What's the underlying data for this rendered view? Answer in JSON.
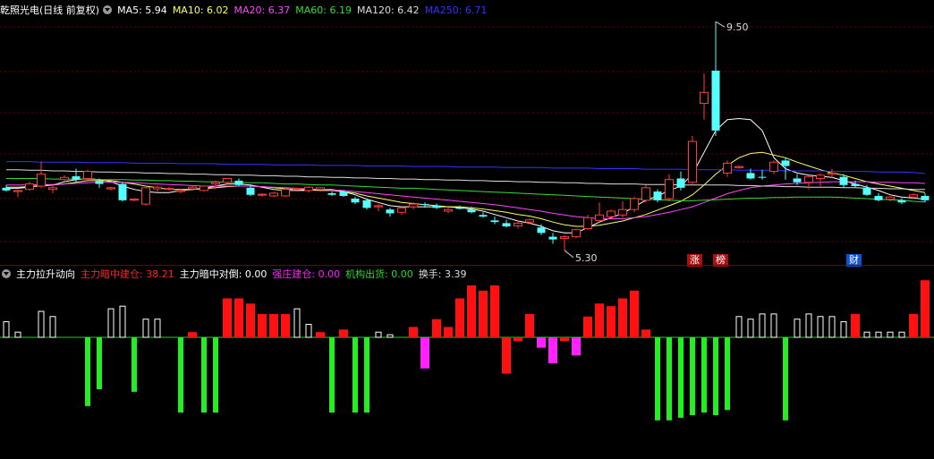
{
  "main_legend": {
    "title": "乾照光电(日线 前复权)",
    "items": [
      {
        "label": "MA5:",
        "value": "5.94",
        "color": "#ffffff"
      },
      {
        "label": "MA10:",
        "value": "6.02",
        "color": "#ffff66"
      },
      {
        "label": "MA20:",
        "value": "6.37",
        "color": "#ff44ff"
      },
      {
        "label": "MA60:",
        "value": "6.19",
        "color": "#33dd33"
      },
      {
        "label": "MA120:",
        "value": "6.42",
        "color": "#dddddd"
      },
      {
        "label": "MA250:",
        "value": "6.71",
        "color": "#3333ff"
      }
    ]
  },
  "price_annotations": {
    "high": "9.50",
    "low": "5.30"
  },
  "badges": [
    {
      "text": "涨",
      "bg": "#aa1111",
      "color": "#ffffff"
    },
    {
      "text": "榜",
      "bg": "#aa1111",
      "color": "#ffffff"
    },
    {
      "text": "财",
      "bg": "#1155cc",
      "color": "#ffffff"
    }
  ],
  "sub_legend": {
    "title": "主力拉升动向",
    "items": [
      {
        "label": "主力暗中建仓:",
        "value": "38.21",
        "color": "#ff2222"
      },
      {
        "label": "主力暗中对倒:",
        "value": "0.00",
        "color": "#ffffff"
      },
      {
        "label": "强庄建仓:",
        "value": "0.00",
        "color": "#ff22ff"
      },
      {
        "label": "机构出货:",
        "value": "0.00",
        "color": "#22dd22"
      },
      {
        "label": "换手:",
        "value": "3.39",
        "color": "#dddddd"
      }
    ]
  },
  "chart_data": {
    "type": "candlestick",
    "y_range": [
      5.1,
      9.7
    ],
    "candles": [
      [
        6.45,
        6.5,
        6.38,
        6.4
      ],
      [
        6.38,
        6.42,
        6.28,
        6.4
      ],
      [
        6.42,
        6.56,
        6.4,
        6.52
      ],
      [
        6.48,
        6.93,
        6.45,
        6.7
      ],
      [
        6.42,
        6.48,
        6.35,
        6.45
      ],
      [
        6.6,
        6.68,
        6.58,
        6.64
      ],
      [
        6.66,
        6.8,
        6.55,
        6.6
      ],
      [
        6.62,
        6.78,
        6.6,
        6.75
      ],
      [
        6.57,
        6.62,
        6.45,
        6.52
      ],
      [
        6.43,
        6.47,
        6.4,
        6.45
      ],
      [
        6.52,
        6.55,
        6.2,
        6.22
      ],
      [
        6.23,
        6.26,
        6.2,
        6.24
      ],
      [
        6.15,
        6.5,
        6.12,
        6.45
      ],
      [
        6.43,
        6.48,
        6.38,
        6.46
      ],
      [
        6.42,
        6.46,
        6.4,
        6.44
      ],
      [
        6.38,
        6.42,
        6.35,
        6.4
      ],
      [
        6.43,
        6.48,
        6.4,
        6.46
      ],
      [
        6.4,
        6.5,
        6.38,
        6.48
      ],
      [
        6.52,
        6.58,
        6.42,
        6.55
      ],
      [
        6.55,
        6.62,
        6.52,
        6.62
      ],
      [
        6.58,
        6.62,
        6.48,
        6.5
      ],
      [
        6.45,
        6.5,
        6.3,
        6.32
      ],
      [
        6.32,
        6.35,
        6.28,
        6.33
      ],
      [
        6.3,
        6.38,
        6.28,
        6.35
      ],
      [
        6.3,
        6.45,
        6.28,
        6.42
      ],
      [
        6.42,
        6.45,
        6.38,
        6.44
      ],
      [
        6.4,
        6.48,
        6.36,
        6.46
      ],
      [
        6.42,
        6.46,
        6.38,
        6.45
      ],
      [
        6.35,
        6.38,
        6.3,
        6.32
      ],
      [
        6.38,
        6.4,
        6.28,
        6.3
      ],
      [
        6.25,
        6.28,
        6.15,
        6.18
      ],
      [
        6.22,
        6.24,
        6.05,
        6.08
      ],
      [
        6.1,
        6.15,
        6.02,
        6.12
      ],
      [
        6.05,
        6.08,
        5.92,
        5.98
      ],
      [
        6.0,
        6.1,
        5.95,
        6.08
      ],
      [
        6.1,
        6.18,
        6.05,
        6.15
      ],
      [
        6.15,
        6.18,
        6.08,
        6.14
      ],
      [
        6.12,
        6.16,
        6.06,
        6.08
      ],
      [
        6.02,
        6.08,
        5.98,
        6.05
      ],
      [
        6.08,
        6.12,
        6.05,
        6.07
      ],
      [
        6.05,
        6.1,
        5.98,
        6.0
      ],
      [
        5.95,
        6.0,
        5.9,
        5.92
      ],
      [
        5.85,
        5.92,
        5.78,
        5.82
      ],
      [
        5.8,
        5.86,
        5.72,
        5.74
      ],
      [
        5.75,
        5.85,
        5.7,
        5.8
      ],
      [
        5.82,
        5.88,
        5.78,
        5.86
      ],
      [
        5.72,
        5.78,
        5.58,
        5.62
      ],
      [
        5.55,
        5.62,
        5.42,
        5.5
      ],
      [
        5.52,
        5.58,
        5.3,
        5.55
      ],
      [
        5.55,
        5.7,
        5.52,
        5.68
      ],
      [
        5.7,
        5.95,
        5.68,
        5.9
      ],
      [
        5.85,
        6.18,
        5.82,
        5.95
      ],
      [
        5.92,
        6.05,
        5.88,
        6.02
      ],
      [
        5.95,
        6.2,
        5.9,
        6.05
      ],
      [
        6.05,
        6.28,
        6.0,
        6.25
      ],
      [
        6.22,
        6.5,
        6.18,
        6.45
      ],
      [
        6.38,
        6.42,
        6.18,
        6.22
      ],
      [
        6.25,
        6.7,
        6.2,
        6.6
      ],
      [
        6.62,
        6.75,
        6.4,
        6.45
      ],
      [
        6.55,
        7.4,
        6.5,
        7.3
      ],
      [
        8.0,
        8.55,
        7.7,
        8.2
      ],
      [
        8.6,
        9.5,
        7.4,
        7.5
      ],
      [
        6.72,
        6.95,
        6.65,
        6.9
      ],
      [
        6.82,
        6.86,
        6.8,
        6.84
      ],
      [
        6.72,
        6.8,
        6.6,
        6.62
      ],
      [
        6.65,
        6.78,
        6.6,
        6.64
      ],
      [
        6.75,
        6.95,
        6.7,
        6.92
      ],
      [
        6.95,
        7.0,
        6.6,
        6.85
      ],
      [
        6.62,
        6.7,
        6.5,
        6.55
      ],
      [
        6.55,
        6.68,
        6.42,
        6.65
      ],
      [
        6.62,
        6.72,
        6.48,
        6.68
      ],
      [
        6.7,
        6.8,
        6.62,
        6.72
      ],
      [
        6.65,
        6.7,
        6.45,
        6.5
      ],
      [
        6.52,
        6.58,
        6.45,
        6.48
      ],
      [
        6.45,
        6.5,
        6.3,
        6.32
      ],
      [
        6.3,
        6.35,
        6.2,
        6.22
      ],
      [
        6.24,
        6.3,
        6.2,
        6.28
      ],
      [
        6.22,
        6.26,
        6.15,
        6.18
      ],
      [
        6.28,
        6.35,
        6.25,
        6.32
      ],
      [
        6.3,
        6.35,
        6.18,
        6.22
      ]
    ],
    "ma_lines": [
      {
        "name": "MA5",
        "color": "#ffffff",
        "values": [
          6.44,
          6.44,
          6.46,
          6.5,
          6.5,
          6.56,
          6.6,
          6.62,
          6.6,
          6.56,
          6.48,
          6.42,
          6.38,
          6.36,
          6.36,
          6.4,
          6.42,
          6.44,
          6.48,
          6.52,
          6.52,
          6.5,
          6.46,
          6.42,
          6.4,
          6.4,
          6.4,
          6.42,
          6.42,
          6.38,
          6.32,
          6.24,
          6.18,
          6.12,
          6.1,
          6.1,
          6.1,
          6.1,
          6.1,
          6.08,
          6.06,
          6.02,
          5.96,
          5.9,
          5.84,
          5.8,
          5.74,
          5.66,
          5.62,
          5.62,
          5.72,
          5.82,
          5.9,
          5.98,
          6.1,
          6.22,
          6.3,
          6.4,
          6.48,
          6.7,
          7.1,
          7.5,
          7.7,
          7.72,
          7.7,
          7.5,
          7.0,
          6.8,
          6.72,
          6.68,
          6.66,
          6.64,
          6.58,
          6.52,
          6.46,
          6.4,
          6.32,
          6.28,
          6.26,
          6.24
        ]
      },
      {
        "name": "MA10",
        "color": "#ffff66",
        "values": [
          6.46,
          6.46,
          6.47,
          6.48,
          6.5,
          6.52,
          6.55,
          6.58,
          6.58,
          6.58,
          6.55,
          6.52,
          6.48,
          6.45,
          6.42,
          6.42,
          6.42,
          6.43,
          6.45,
          6.47,
          6.48,
          6.48,
          6.47,
          6.45,
          6.43,
          6.42,
          6.41,
          6.4,
          6.4,
          6.38,
          6.35,
          6.3,
          6.26,
          6.22,
          6.18,
          6.16,
          6.14,
          6.12,
          6.1,
          6.1,
          6.08,
          6.06,
          6.03,
          6.0,
          5.96,
          5.93,
          5.88,
          5.82,
          5.77,
          5.74,
          5.74,
          5.76,
          5.8,
          5.84,
          5.9,
          5.96,
          6.04,
          6.12,
          6.2,
          6.32,
          6.5,
          6.7,
          6.86,
          7.0,
          7.08,
          7.1,
          7.05,
          7.0,
          6.92,
          6.85,
          6.78,
          6.72,
          6.68,
          6.62,
          6.56,
          6.52,
          6.48,
          6.44,
          6.4,
          6.36
        ]
      },
      {
        "name": "MA20",
        "color": "#ff44ff",
        "values": [
          6.5,
          6.5,
          6.5,
          6.51,
          6.51,
          6.52,
          6.53,
          6.54,
          6.55,
          6.55,
          6.55,
          6.54,
          6.53,
          6.52,
          6.51,
          6.5,
          6.49,
          6.48,
          6.48,
          6.48,
          6.48,
          6.48,
          6.47,
          6.46,
          6.45,
          6.44,
          6.43,
          6.42,
          6.41,
          6.4,
          6.38,
          6.36,
          6.34,
          6.32,
          6.3,
          6.28,
          6.26,
          6.24,
          6.22,
          6.2,
          6.18,
          6.16,
          6.14,
          6.11,
          6.08,
          6.05,
          6.02,
          5.98,
          5.95,
          5.92,
          5.9,
          5.88,
          5.88,
          5.88,
          5.9,
          5.92,
          5.96,
          6.0,
          6.05,
          6.1,
          6.18,
          6.26,
          6.34,
          6.4,
          6.45,
          6.48,
          6.5,
          6.52,
          6.53,
          6.54,
          6.55,
          6.56,
          6.56,
          6.56,
          6.56,
          6.55,
          6.55,
          6.54,
          6.54,
          6.53
        ]
      },
      {
        "name": "MA60",
        "color": "#33dd33",
        "values": [
          6.62,
          6.62,
          6.62,
          6.62,
          6.61,
          6.61,
          6.61,
          6.61,
          6.6,
          6.6,
          6.6,
          6.59,
          6.59,
          6.58,
          6.58,
          6.57,
          6.57,
          6.56,
          6.56,
          6.55,
          6.55,
          6.54,
          6.54,
          6.53,
          6.52,
          6.52,
          6.51,
          6.5,
          6.5,
          6.49,
          6.48,
          6.47,
          6.46,
          6.45,
          6.44,
          6.44,
          6.43,
          6.42,
          6.41,
          6.4,
          6.39,
          6.38,
          6.37,
          6.36,
          6.35,
          6.34,
          6.33,
          6.32,
          6.31,
          6.3,
          6.29,
          6.28,
          6.27,
          6.26,
          6.25,
          6.24,
          6.23,
          6.22,
          6.21,
          6.21,
          6.22,
          6.23,
          6.24,
          6.25,
          6.26,
          6.26,
          6.27,
          6.27,
          6.28,
          6.28,
          6.28,
          6.28,
          6.27,
          6.26,
          6.25,
          6.24,
          6.23,
          6.22,
          6.2,
          6.19
        ]
      },
      {
        "name": "MA120",
        "color": "#dddddd",
        "values": [
          6.78,
          6.78,
          6.77,
          6.77,
          6.76,
          6.76,
          6.75,
          6.75,
          6.74,
          6.74,
          6.73,
          6.73,
          6.72,
          6.72,
          6.71,
          6.71,
          6.7,
          6.7,
          6.69,
          6.69,
          6.68,
          6.68,
          6.67,
          6.67,
          6.66,
          6.66,
          6.65,
          6.65,
          6.64,
          6.64,
          6.63,
          6.63,
          6.62,
          6.62,
          6.61,
          6.61,
          6.6,
          6.6,
          6.59,
          6.59,
          6.58,
          6.58,
          6.57,
          6.57,
          6.56,
          6.56,
          6.55,
          6.55,
          6.54,
          6.54,
          6.53,
          6.53,
          6.52,
          6.52,
          6.52,
          6.51,
          6.51,
          6.51,
          6.5,
          6.5,
          6.5,
          6.5,
          6.5,
          6.49,
          6.49,
          6.48,
          6.48,
          6.47,
          6.47,
          6.46,
          6.46,
          6.46,
          6.45,
          6.45,
          6.44,
          6.44,
          6.43,
          6.43,
          6.42,
          6.42
        ]
      },
      {
        "name": "MA250",
        "color": "#3333ff",
        "values": [
          6.93,
          6.93,
          6.93,
          6.92,
          6.92,
          6.92,
          6.92,
          6.91,
          6.91,
          6.91,
          6.91,
          6.9,
          6.9,
          6.9,
          6.9,
          6.89,
          6.89,
          6.89,
          6.89,
          6.88,
          6.88,
          6.88,
          6.88,
          6.87,
          6.87,
          6.87,
          6.87,
          6.86,
          6.86,
          6.86,
          6.86,
          6.85,
          6.85,
          6.85,
          6.85,
          6.84,
          6.84,
          6.84,
          6.84,
          6.83,
          6.83,
          6.83,
          6.83,
          6.82,
          6.82,
          6.82,
          6.82,
          6.81,
          6.81,
          6.81,
          6.81,
          6.8,
          6.8,
          6.8,
          6.8,
          6.79,
          6.79,
          6.79,
          6.79,
          6.78,
          6.78,
          6.78,
          6.78,
          6.77,
          6.77,
          6.77,
          6.77,
          6.76,
          6.76,
          6.76,
          6.76,
          6.75,
          6.75,
          6.75,
          6.75,
          6.74,
          6.74,
          6.74,
          6.73,
          6.71
        ]
      }
    ],
    "indicator_range": [
      -60,
      40
    ],
    "indicator_bars": [
      [
        12,
        "white"
      ],
      [
        4,
        "white"
      ],
      [
        0,
        "white"
      ],
      [
        20,
        "white"
      ],
      [
        16,
        "white"
      ],
      [
        0,
        "white"
      ],
      [
        0,
        "white"
      ],
      [
        -53,
        "green"
      ],
      [
        -40,
        "green"
      ],
      [
        22,
        "white"
      ],
      [
        24,
        "white"
      ],
      [
        -42,
        "green"
      ],
      [
        14,
        "white"
      ],
      [
        14,
        "white"
      ],
      [
        0,
        "white"
      ],
      [
        -58,
        "green"
      ],
      [
        4,
        "red"
      ],
      [
        -58,
        "green"
      ],
      [
        -58,
        "green"
      ],
      [
        30,
        "red"
      ],
      [
        30,
        "red"
      ],
      [
        26,
        "red"
      ],
      [
        18,
        "red"
      ],
      [
        18,
        "red"
      ],
      [
        18,
        "red"
      ],
      [
        22,
        "white"
      ],
      [
        10,
        "white"
      ],
      [
        4,
        "red"
      ],
      [
        -58,
        "green"
      ],
      [
        6,
        "red"
      ],
      [
        -58,
        "green"
      ],
      [
        -58,
        "green"
      ],
      [
        4,
        "white"
      ],
      [
        2,
        "white"
      ],
      [
        0,
        "white"
      ],
      [
        8,
        "red"
      ],
      [
        -24,
        "magenta"
      ],
      [
        14,
        "red"
      ],
      [
        8,
        "red"
      ],
      [
        30,
        "red"
      ],
      [
        40,
        "red"
      ],
      [
        36,
        "red"
      ],
      [
        40,
        "red"
      ],
      [
        -28,
        "red"
      ],
      [
        -3,
        "red"
      ],
      [
        18,
        "red"
      ],
      [
        -8,
        "magenta"
      ],
      [
        -20,
        "magenta"
      ],
      [
        -3,
        "red"
      ],
      [
        -14,
        "magenta"
      ],
      [
        16,
        "red"
      ],
      [
        26,
        "red"
      ],
      [
        24,
        "red"
      ],
      [
        30,
        "red"
      ],
      [
        36,
        "red"
      ],
      [
        6,
        "red"
      ],
      [
        -64,
        "green"
      ],
      [
        -64,
        "green"
      ],
      [
        -62,
        "green"
      ],
      [
        -60,
        "green"
      ],
      [
        -58,
        "green"
      ],
      [
        -60,
        "green"
      ],
      [
        -56,
        "green"
      ],
      [
        16,
        "white"
      ],
      [
        14,
        "white"
      ],
      [
        18,
        "white"
      ],
      [
        18,
        "white"
      ],
      [
        -64,
        "green"
      ],
      [
        14,
        "white"
      ],
      [
        18,
        "white"
      ],
      [
        16,
        "white"
      ],
      [
        16,
        "white"
      ],
      [
        12,
        "white"
      ],
      [
        18,
        "red"
      ],
      [
        4,
        "white"
      ],
      [
        4,
        "white"
      ],
      [
        4,
        "white"
      ],
      [
        4,
        "white"
      ],
      [
        18,
        "red"
      ],
      [
        44,
        "red"
      ]
    ]
  }
}
